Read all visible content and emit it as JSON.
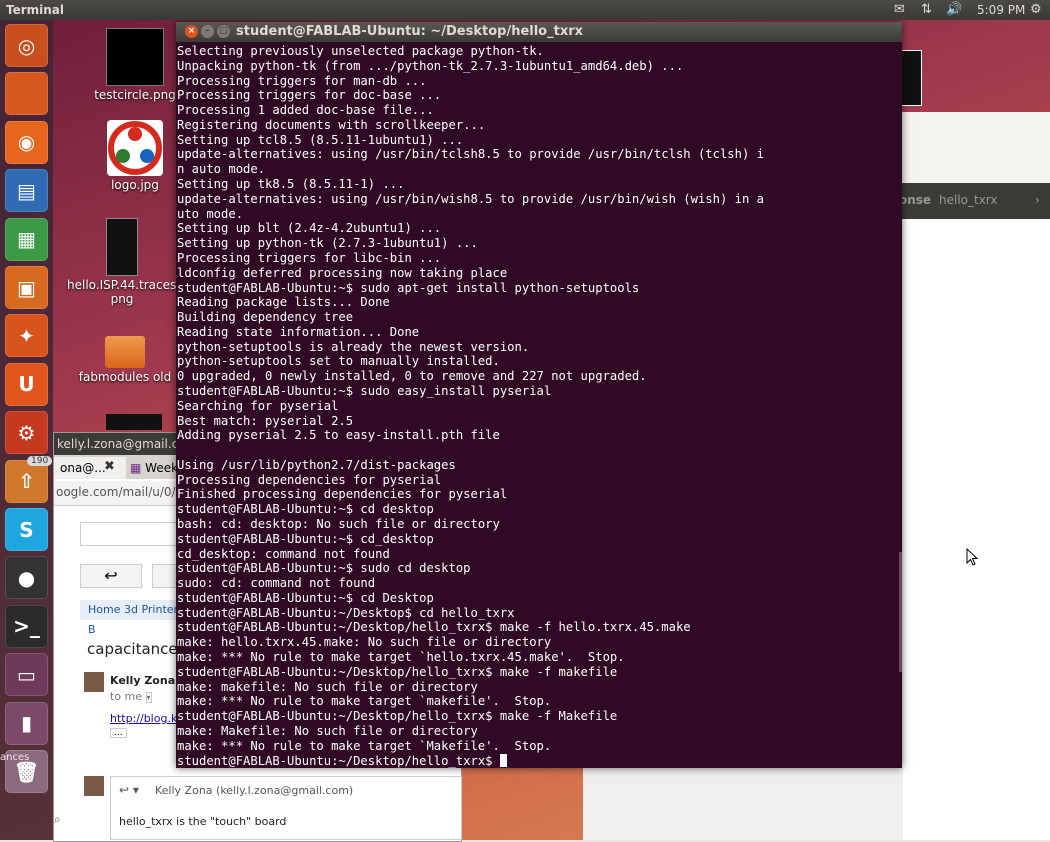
{
  "top_panel": {
    "app_title": "Terminal",
    "clock": "5:09 PM",
    "indicators": [
      "mail-icon",
      "network-icon",
      "volume-icon",
      "gear-icon"
    ]
  },
  "launcher": {
    "items": [
      {
        "name": "dash-home",
        "color": "#c94f1f"
      },
      {
        "name": "files",
        "color": "#d7581e"
      },
      {
        "name": "firefox",
        "color": "#e7651c"
      },
      {
        "name": "libreoffice-writer",
        "color": "#2f6bb3"
      },
      {
        "name": "libreoffice-calc",
        "color": "#3a9a45"
      },
      {
        "name": "libreoffice-impress",
        "color": "#d86a1f"
      },
      {
        "name": "software-center",
        "color": "#d9541d"
      },
      {
        "name": "ubuntu-one",
        "color": "#e1561c"
      },
      {
        "name": "system-settings",
        "color": "#c5391e"
      },
      {
        "name": "update-manager",
        "color": "#d1772b",
        "badge": "190"
      },
      {
        "name": "skype",
        "color": "#1ea7df"
      },
      {
        "name": "camera",
        "color": "#333333"
      },
      {
        "name": "terminal",
        "color": "#2b2b2b"
      },
      {
        "name": "workspace-switcher",
        "color": "#6d3b59"
      },
      {
        "name": "usb-drive",
        "color": "#7b4a68"
      },
      {
        "name": "trash",
        "color": "#8a6a7c"
      }
    ]
  },
  "desktop_icons": [
    {
      "label": "testcircle.png"
    },
    {
      "label": "logo.jpg"
    },
    {
      "label": "hello.ISP.44.traces.\npng"
    },
    {
      "label": "fabmodules old"
    }
  ],
  "launcher_text": "ances",
  "browser": {
    "title": "kelly.l.zona@gmail.c",
    "tab1": "ona@...",
    "tab2": "Week5",
    "url": "oogle.com/mail/u/0/#i",
    "bookmarks": "Home 3d Printer B",
    "subject": "capacitance",
    "sender": "Kelly Zona",
    "sender_suffix": "<",
    "to": "to me",
    "link": "http://blog.kaz",
    "reply_from": "Kelly Zona (kelly.l.zona@gmail.com)",
    "reply_body": "hello_txrx is the \"touch\" board",
    "ellipsis": "..."
  },
  "right_window": {
    "tab_partial": "onse",
    "tab_label": "hello_txrx"
  },
  "terminal": {
    "title": "student@FABLAB-Ubuntu: ~/Desktop/hello_txrx",
    "lines": [
      "Selecting previously unselected package python-tk.",
      "Unpacking python-tk (from .../python-tk_2.7.3-1ubuntu1_amd64.deb) ...",
      "Processing triggers for man-db ...",
      "Processing triggers for doc-base ...",
      "Processing 1 added doc-base file...",
      "Registering documents with scrollkeeper...",
      "Setting up tcl8.5 (8.5.11-1ubuntu1) ...",
      "update-alternatives: using /usr/bin/tclsh8.5 to provide /usr/bin/tclsh (tclsh) i",
      "n auto mode.",
      "Setting up tk8.5 (8.5.11-1) ...",
      "update-alternatives: using /usr/bin/wish8.5 to provide /usr/bin/wish (wish) in a",
      "uto mode.",
      "Setting up blt (2.4z-4.2ubuntu1) ...",
      "Setting up python-tk (2.7.3-1ubuntu1) ...",
      "Processing triggers for libc-bin ...",
      "ldconfig deferred processing now taking place",
      "student@FABLAB-Ubuntu:~$ sudo apt-get install python-setuptools",
      "Reading package lists... Done",
      "Building dependency tree",
      "Reading state information... Done",
      "python-setuptools is already the newest version.",
      "python-setuptools set to manually installed.",
      "0 upgraded, 0 newly installed, 0 to remove and 227 not upgraded.",
      "student@FABLAB-Ubuntu:~$ sudo easy_install pyserial",
      "Searching for pyserial",
      "Best match: pyserial 2.5",
      "Adding pyserial 2.5 to easy-install.pth file",
      "",
      "Using /usr/lib/python2.7/dist-packages",
      "Processing dependencies for pyserial",
      "Finished processing dependencies for pyserial",
      "student@FABLAB-Ubuntu:~$ cd desktop",
      "bash: cd: desktop: No such file or directory",
      "student@FABLAB-Ubuntu:~$ cd_desktop",
      "cd_desktop: command not found",
      "student@FABLAB-Ubuntu:~$ sudo cd desktop",
      "sudo: cd: command not found",
      "student@FABLAB-Ubuntu:~$ cd Desktop",
      "student@FABLAB-Ubuntu:~/Desktop$ cd hello_txrx",
      "student@FABLAB-Ubuntu:~/Desktop/hello_txrx$ make -f hello.txrx.45.make",
      "make: hello.txrx.45.make: No such file or directory",
      "make: *** No rule to make target `hello.txrx.45.make'.  Stop.",
      "student@FABLAB-Ubuntu:~/Desktop/hello_txrx$ make -f makefile",
      "make: makefile: No such file or directory",
      "make: *** No rule to make target `makefile'.  Stop.",
      "student@FABLAB-Ubuntu:~/Desktop/hello_txrx$ make -f Makefile",
      "make: Makefile: No such file or directory",
      "make: *** No rule to make target `Makefile'.  Stop."
    ],
    "prompt": "student@FABLAB-Ubuntu:~/Desktop/hello_txrx$ "
  }
}
